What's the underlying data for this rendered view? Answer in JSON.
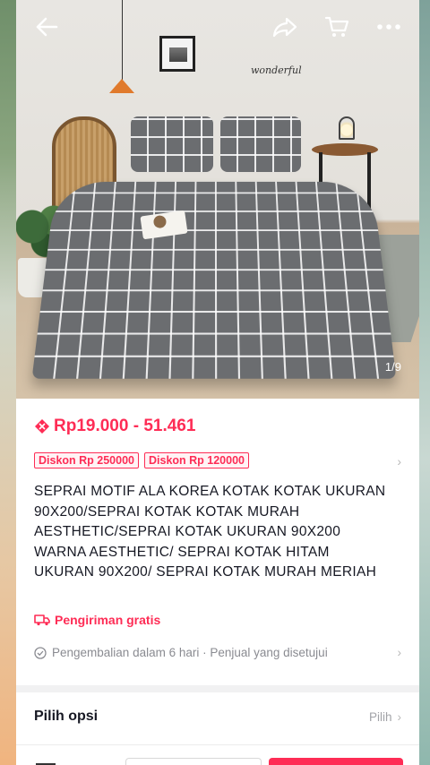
{
  "topbar": {
    "back_icon": "arrow-left-icon",
    "share_icon": "share-icon",
    "cart_icon": "cart-icon",
    "more_icon": "more-icon"
  },
  "gallery": {
    "counter": "1/9",
    "wall_text": "wonderful"
  },
  "product": {
    "price": "Rp19.000 - 51.461",
    "badges": [
      "Diskon Rp 250000",
      "Diskon Rp 120000"
    ],
    "title": "SEPRAI MOTIF ALA KOREA KOTAK KOTAK UKURAN 90X200/SEPRAI KOTAK KOTAK MURAH AESTHETIC/SEPRAI KOTAK UKURAN 90X200 WARNA AESTHETIC/ SEPRAI KOTAK HITAM UKURAN 90X200/ SEPRAI KOTAK MURAH MERIAH",
    "shipping": "Pengiriman gratis",
    "returns": "Pengembalian dalam 6 hari · Penjual yang disetujui"
  },
  "options": {
    "title": "Pilih opsi",
    "value": "Pilih"
  },
  "colors": {
    "accent": "#fe2c55",
    "text": "#161823",
    "muted": "#8a8b91"
  }
}
